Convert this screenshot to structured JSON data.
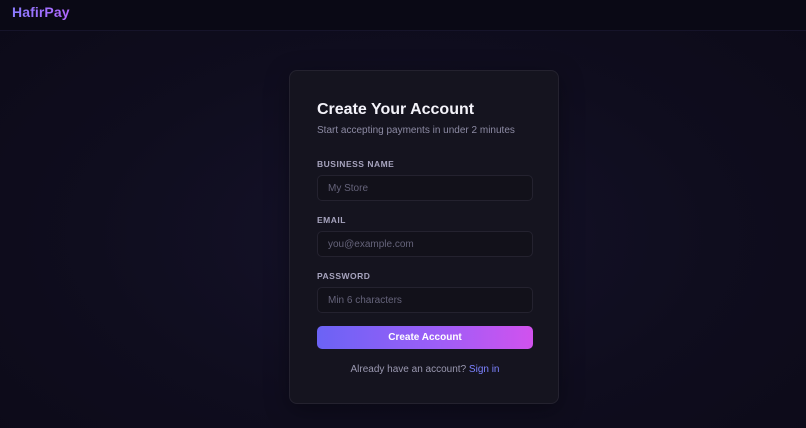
{
  "header": {
    "brand": "HafirPay"
  },
  "form": {
    "title": "Create Your Account",
    "subtitle": "Start accepting payments in under 2 minutes",
    "fields": [
      {
        "label": "BUSINESS NAME",
        "value": "",
        "placeholder": "My Store"
      },
      {
        "label": "EMAIL",
        "value": "",
        "placeholder": "you@example.com"
      },
      {
        "label": "PASSWORD",
        "value": "",
        "placeholder": "Min 6 characters"
      }
    ],
    "submit_label": "Create Account",
    "signin_prompt": "Already have an account?",
    "signin_link": "Sign in"
  },
  "colors": {
    "accent_start": "#6b63f5",
    "accent_end": "#d152ee",
    "link": "#7c82ff",
    "background": "#0e0c1c",
    "card": "#15141f"
  }
}
